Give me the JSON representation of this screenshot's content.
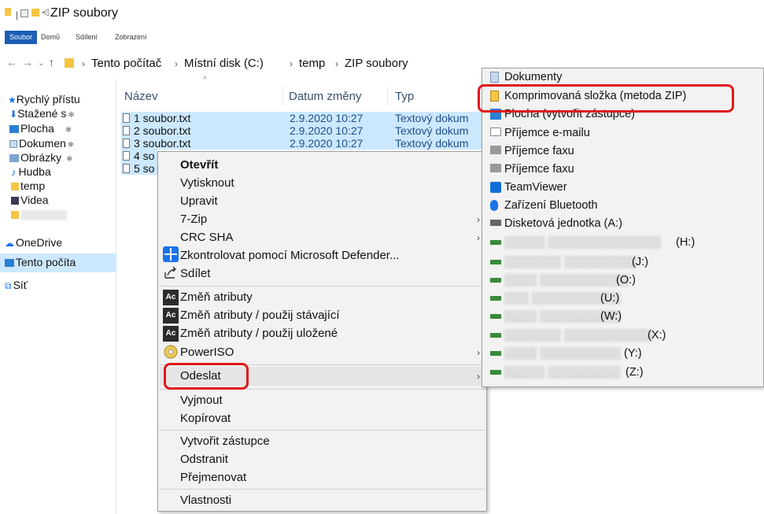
{
  "window": {
    "title": "ZIP soubory"
  },
  "ribbon": {
    "tabs": [
      "Soubor",
      "Domů",
      "Sdílení",
      "Zobrazení"
    ]
  },
  "address": {
    "crumbs": [
      "Tento počítač",
      "Místní disk (C:)",
      "temp",
      "ZIP soubory"
    ]
  },
  "nav": {
    "items": [
      {
        "label": "Rychlý přístu",
        "icon": "star-icon"
      },
      {
        "label": "Stažené s",
        "icon": "download-icon"
      },
      {
        "label": "Plocha",
        "icon": "desktop-icon"
      },
      {
        "label": "Dokumen",
        "icon": "documents-icon"
      },
      {
        "label": "Obrázky",
        "icon": "pictures-icon"
      },
      {
        "label": "Hudba",
        "icon": "music-icon"
      },
      {
        "label": "temp",
        "icon": "folder-icon"
      },
      {
        "label": "Videa",
        "icon": "video-icon"
      },
      {
        "label": "OneDrive",
        "icon": "cloud-icon"
      },
      {
        "label": "Tento počíta",
        "icon": "computer-icon"
      },
      {
        "label": "Síť",
        "icon": "network-icon"
      }
    ]
  },
  "files": {
    "columns": [
      "Název",
      "Datum změny",
      "Typ"
    ],
    "rows": [
      {
        "name": "1 soubor.txt",
        "date": "2.9.2020 10:27",
        "type": "Textový dokum"
      },
      {
        "name": "2 soubor.txt",
        "date": "2.9.2020 10:27",
        "type": "Textový dokum"
      },
      {
        "name": "3 soubor.txt",
        "date": "2.9.2020 10:27",
        "type": "Textový dokum"
      },
      {
        "name": "4 so",
        "date": "",
        "type": ""
      },
      {
        "name": "5 so",
        "date": "",
        "type": ""
      }
    ]
  },
  "context_menu": {
    "open": "Otevřít",
    "print": "Vytisknout",
    "edit": "Upravit",
    "zip7": "7-Zip",
    "crc": "CRC SHA",
    "defender": "Zkontrolovat pomocí Microsoft Defender...",
    "share": "Sdílet",
    "attr1": "Změň atributy",
    "attr2": "Změň atributy / použij stávající",
    "attr3": "Změň atributy / použij uložené",
    "poweriso": "PowerISO",
    "sendto": "Odeslat",
    "cut": "Vyjmout",
    "copy": "Kopírovat",
    "shortcut": "Vytvořit zástupce",
    "delete": "Odstranit",
    "rename": "Přejmenovat",
    "properties": "Vlastnosti",
    "ac_badge": "Ac"
  },
  "submenu": {
    "items": [
      "Dokumenty",
      "Komprimovaná složka (metoda ZIP)",
      "Plocha (vytvořit zástupce)",
      "Příjemce e-mailu",
      "Příjemce faxu",
      "Příjemce faxu",
      "TeamViewer",
      "Zařízení Bluetooth",
      "Disketová jednotka (A:)"
    ],
    "drives": [
      "(H:)",
      "(J:)",
      "(O:)",
      "(U:)",
      "(W:)",
      "(X:)",
      "(Y:)",
      "(Z:)"
    ]
  },
  "colors": {
    "selection": "#cce8ff",
    "accent": "#1a5fb4",
    "highlight": "#e0191b"
  }
}
